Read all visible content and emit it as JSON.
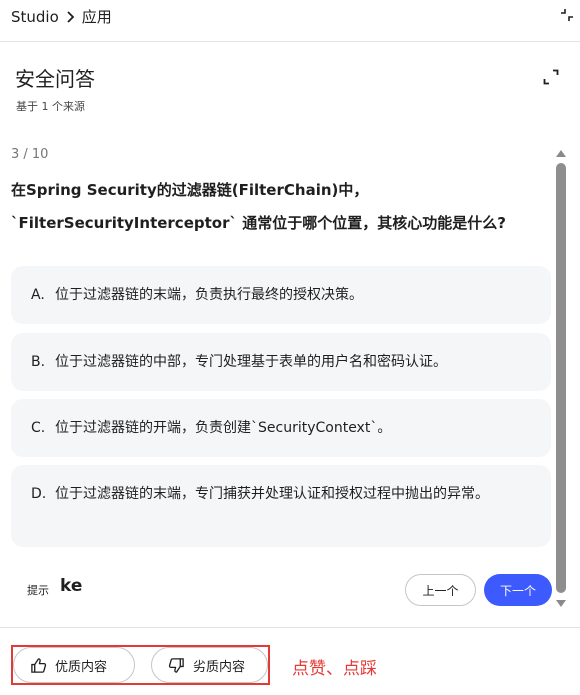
{
  "header": {
    "breadcrumb_root": "Studio",
    "breadcrumb_current": "应用"
  },
  "panel": {
    "title": "安全问答",
    "subtitle": "基于 1 个来源"
  },
  "quiz": {
    "counter": "3 / 10",
    "question": "在Spring Security的过滤器链(FilterChain)中，`FilterSecurityInterceptor` 通常位于哪个位置，其核心功能是什么?",
    "options": [
      {
        "letter": "A.",
        "text": "位于过滤器链的末端，负责执行最终的授权决策。"
      },
      {
        "letter": "B.",
        "text": "位于过滤器链的中部，专门处理基于表单的用户名和密码认证。"
      },
      {
        "letter": "C.",
        "text": "位于过滤器链的开端，负责创建`SecurityContext`。"
      },
      {
        "letter": "D.",
        "text": "位于过滤器链的末端，专门捕获并处理认证和授权过程中抛出的异常。"
      }
    ],
    "hint_label": "提示",
    "hint_value": "ke",
    "prev_label": "上一个",
    "next_label": "下一个"
  },
  "feedback": {
    "good_label": "优质内容",
    "bad_label": "劣质内容",
    "annotation": "点赞、点踩",
    "annotation_color": "#e53935"
  },
  "colors": {
    "accent": "#3d5afe",
    "option_bg": "#f5f6f8"
  },
  "icons": [
    "chevron-right-icon",
    "collapse-icon",
    "expand-icon",
    "thumbs-up-icon",
    "thumbs-down-icon"
  ]
}
